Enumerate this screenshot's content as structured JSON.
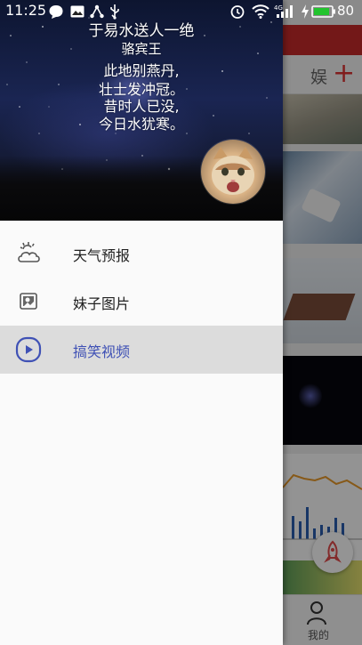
{
  "status_bar": {
    "time": "11:25",
    "battery": "80"
  },
  "drawer": {
    "poem": {
      "title": "于易水送人一绝",
      "author": "骆宾王",
      "lines": [
        "此地别燕丹,",
        "壮士发冲冠。",
        "昔时人已没,",
        "今日水犹寒。"
      ]
    },
    "menu": [
      {
        "label": "天气预报",
        "icon": "weather-icon",
        "selected": false
      },
      {
        "label": "妹子图片",
        "icon": "picture-icon",
        "selected": false
      },
      {
        "label": "搞笑视频",
        "icon": "play-icon",
        "selected": true
      }
    ]
  },
  "background_app": {
    "tab_label": "娱",
    "bottom_nav_label": "我的"
  },
  "colors": {
    "accent": "#3f51b5",
    "toolbar": "#c62a2a",
    "battery": "#22c32e"
  }
}
